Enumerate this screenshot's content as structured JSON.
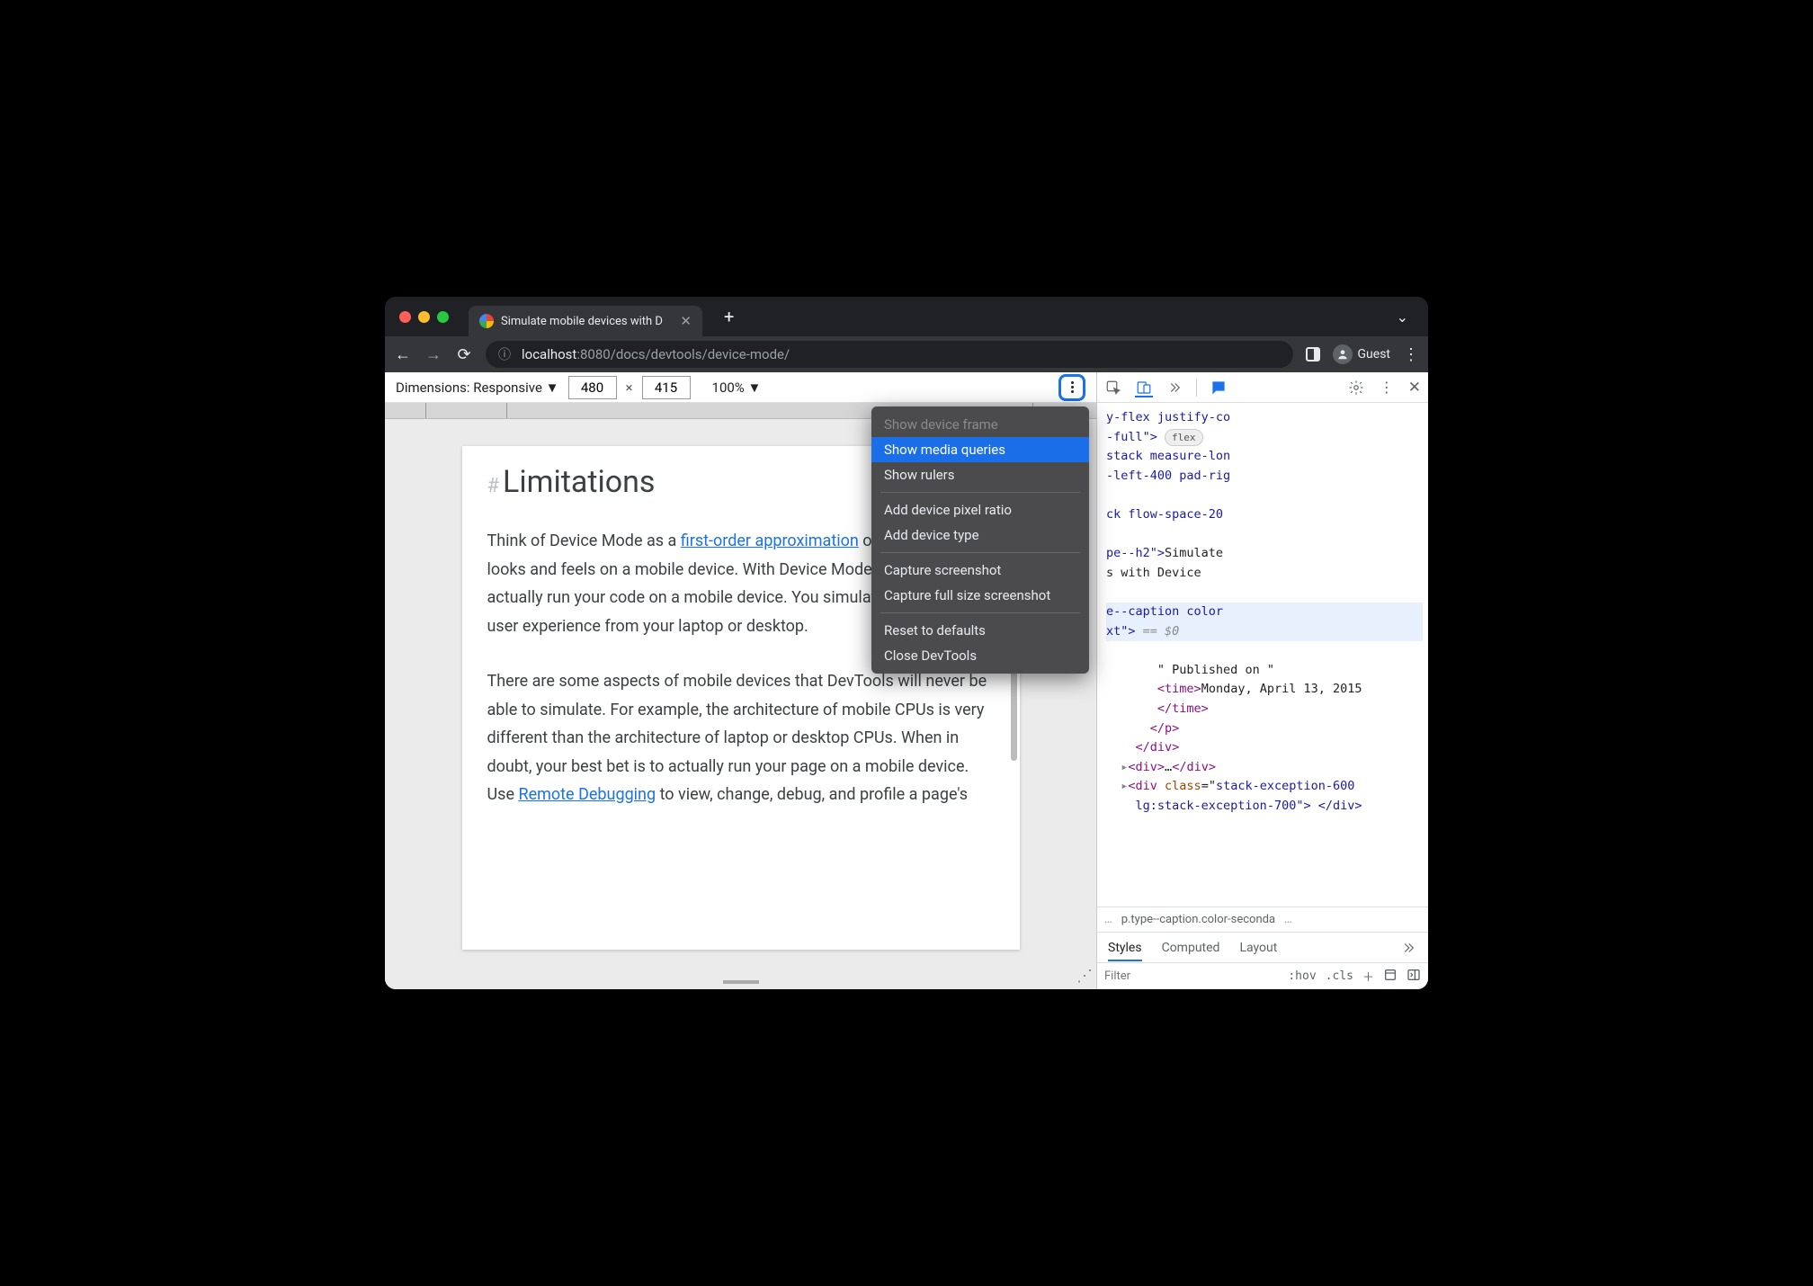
{
  "browser": {
    "tab_title": "Simulate mobile devices with D",
    "url_host": "localhost",
    "url_port": ":8080",
    "url_path": "/docs/devtools/device-mode/",
    "profile_label": "Guest"
  },
  "device_toolbar": {
    "dimensions_label": "Dimensions: Responsive",
    "width": "480",
    "height": "415",
    "zoom": "100%"
  },
  "menu": {
    "items": [
      {
        "label": "Show device frame",
        "disabled": true
      },
      {
        "label": "Show media queries",
        "highlight": true
      },
      {
        "label": "Show rulers"
      }
    ],
    "group2": [
      {
        "label": "Add device pixel ratio"
      },
      {
        "label": "Add device type"
      }
    ],
    "group3": [
      {
        "label": "Capture screenshot"
      },
      {
        "label": "Capture full size screenshot"
      }
    ],
    "group4": [
      {
        "label": "Reset to defaults"
      },
      {
        "label": "Close DevTools"
      }
    ]
  },
  "doc": {
    "heading": "Limitations",
    "hash": "#",
    "p1_before": "Think of Device Mode as a ",
    "p1_link": "first-order approximation",
    "p1_after": " of how your page looks and feels on a mobile device. With Device Mode you don't actually run your code on a mobile device. You simulate the mobile user experience from your laptop or desktop.",
    "p2_before": "There are some aspects of mobile devices that DevTools will never be able to simulate. For example, the architecture of mobile CPUs is very different than the architecture of laptop or desktop CPUs. When in doubt, your best bet is to actually run your page on a mobile device. Use ",
    "p2_link": "Remote Debugging",
    "p2_after": " to view, change, debug, and profile a page's"
  },
  "elements": {
    "l1a": "y-flex justify-co",
    "l1b": "-full\">",
    "l1badge": "flex",
    "l2": "stack measure-lon",
    "l3": "-left-400 pad-rig",
    "l4": "ck flow-space-20",
    "l5a": "pe--h2\">",
    "l5b": "Simulate",
    "l6": "s with Device",
    "l7a": "e--caption color",
    "l7b": "xt\">",
    "l7eq": " == $0",
    "l8": "\" Published on \"",
    "l9a": "<time>",
    "l9b": "Monday, April 13, 2015",
    "l10": "</time>",
    "l11": "</p>",
    "l12": "</div>",
    "l13a": "<div>",
    "l13b": "…",
    "l13c": "</div>",
    "l14a": "<div ",
    "l14b": "class",
    "l14c": "=\"",
    "l14d": "stack-exception-600",
    "l15": "lg:stack-exception-700\"> </div>"
  },
  "crumbs": {
    "left": "…",
    "mid": "p.type--caption.color-seconda",
    "right": "…"
  },
  "style_tabs": {
    "t1": "Styles",
    "t2": "Computed",
    "t3": "Layout"
  },
  "filterbar": {
    "placeholder": "Filter",
    "hov": ":hov",
    "cls": ".cls"
  }
}
